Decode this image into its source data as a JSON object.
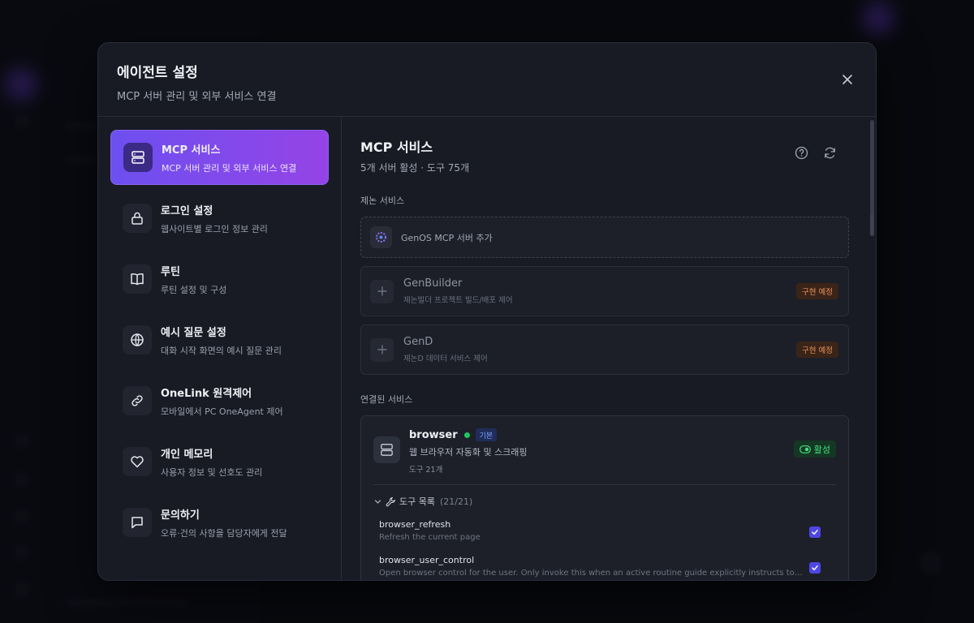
{
  "modal": {
    "title": "에이전트 설정",
    "subtitle": "MCP 서버 관리 및 외부 서비스 연결"
  },
  "nav": {
    "items": [
      {
        "label": "MCP 서비스",
        "desc": "MCP 서버 관리 및 외부 서비스 연결",
        "icon": "server-icon",
        "active": true
      },
      {
        "label": "로그인 설정",
        "desc": "웹사이트별 로그인 정보 관리",
        "icon": "lock-icon"
      },
      {
        "label": "루틴",
        "desc": "루틴 설정 및 구성",
        "icon": "book-icon"
      },
      {
        "label": "예시 질문 설정",
        "desc": "대화 시작 화면의 예시 질문 관리",
        "icon": "globe-icon"
      },
      {
        "label": "OneLink 원격제어",
        "desc": "모바일에서 PC OneAgent 제어",
        "icon": "link-icon"
      },
      {
        "label": "개인 메모리",
        "desc": "사용자 정보 및 선호도 관리",
        "icon": "heart-icon"
      },
      {
        "label": "문의하기",
        "desc": "오류·건의 사항을 담당자에게 전달",
        "icon": "chat-icon"
      }
    ]
  },
  "content": {
    "title": "MCP 서비스",
    "subtitle": "5개 서버 활성 · 도구 75개",
    "genon_section": "제논 서비스",
    "add_server": "GenOS MCP 서버 추가",
    "services": [
      {
        "name": "GenBuilder",
        "desc": "제논빌더 프로젝트 빌드/배포 제어",
        "badge": "구현 예정"
      },
      {
        "name": "GenD",
        "desc": "제논D 데이터 서비스 제어",
        "badge": "구현 예정"
      }
    ],
    "connected_section": "연결된 서비스",
    "connected": {
      "name": "browser",
      "default_badge": "기본",
      "desc": "웹 브라우저 자동화 및 스크래핑",
      "tool_count": "도구 21개",
      "status": "활성",
      "tools_label": "도구 목록",
      "tools_count": "(21/21)",
      "tools": [
        {
          "name": "browser_refresh",
          "desc": "Refresh the current page",
          "checked": true
        },
        {
          "name": "browser_user_control",
          "desc": "Open browser control for the user. Only invoke this when an active routine guide explicitly instructs to call thi...",
          "checked": true
        }
      ]
    }
  },
  "colors": {
    "accent_start": "#6d4ff0",
    "accent_end": "#9544e6",
    "active_green": "#22c55e",
    "soon_orange": "#e8925a",
    "checkbox": "#4f46e5"
  }
}
